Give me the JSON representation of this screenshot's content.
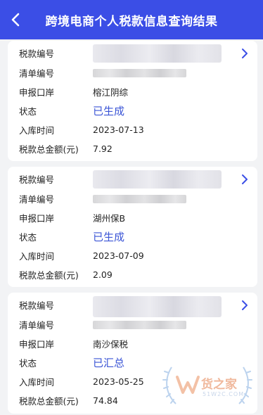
{
  "header": {
    "title": "跨境电商个人税款信息查询结果"
  },
  "labels": {
    "tax_no": "税款编号",
    "list_no": "清单编号",
    "port": "申报口岸",
    "status": "状态",
    "entry_time": "入库时间",
    "total": "税款总金额(元)"
  },
  "records": [
    {
      "port": "榕江阴综",
      "status": "已生成",
      "entry_time": "2023-07-13",
      "total": "7.92"
    },
    {
      "port": "湖州保B",
      "status": "已生成",
      "entry_time": "2023-07-09",
      "total": "2.09"
    },
    {
      "port": "南沙保税",
      "status": "已汇总",
      "entry_time": "2023-05-25",
      "total": "74.84"
    }
  ],
  "watermark": {
    "brand": "货之家",
    "site": "51W2C.COM"
  },
  "colors": {
    "header_bg": "#3b4ee6",
    "status_text": "#3b55d6",
    "page_bg": "#f2f3f5"
  },
  "icons": {
    "back": "chevron-left-icon",
    "detail": "chevron-right-icon"
  }
}
